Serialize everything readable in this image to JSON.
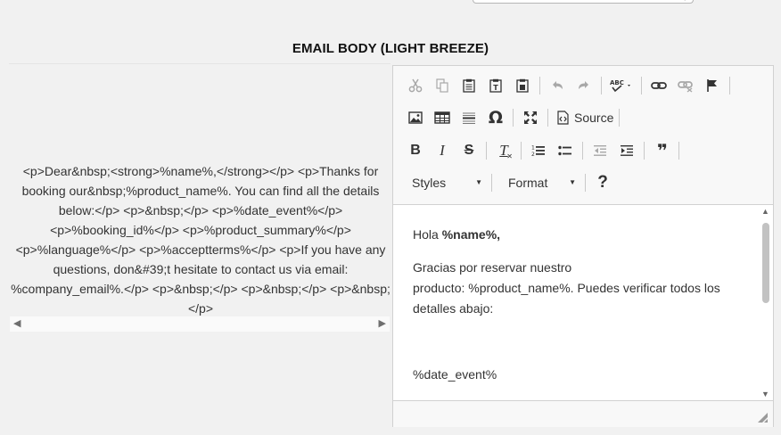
{
  "section": {
    "title": "EMAIL BODY (LIGHT BREEZE)"
  },
  "raw_html": {
    "text": "<p>Dear&nbsp;<strong>%name%,</strong></p> <p>Thanks for booking our&nbsp;%product_name%. You can find all the details below:</p> <p>&nbsp;</p> <p>%date_event%</p> <p>%booking_id%</p> <p>%product_summary%</p> <p>%language%</p> <p>%acceptterms%</p> <p>If you have any questions, don&#39;t hesitate to contact us via email: %company_email%.</p> <p>&nbsp;</p> <p>&nbsp;</p> <p>&nbsp;</p>"
  },
  "toolbar": {
    "row1": [
      "cut-icon",
      "copy-icon",
      "paste-icon",
      "paste-text-icon",
      "paste-word-icon",
      "undo-icon",
      "redo-icon",
      "spellcheck-icon",
      "link-icon",
      "unlink-icon",
      "anchor-flag-icon"
    ],
    "row2": [
      "image-icon",
      "table-icon",
      "horizontal-rule-icon",
      "special-char-icon",
      "maximize-icon",
      "source-icon"
    ],
    "row3": [
      "bold-icon",
      "italic-icon",
      "strike-icon",
      "remove-format-icon",
      "numbered-list-icon",
      "bulleted-list-icon",
      "outdent-icon",
      "indent-icon",
      "blockquote-icon"
    ],
    "source_label": "Source",
    "bold_glyph": "B",
    "italic_glyph": "I",
    "strike_glyph": "S",
    "remove_format_glyph": "T",
    "special_char_glyph": "Ω",
    "blockquote_glyph": "❜❜",
    "styles_label": "Styles",
    "format_label": "Format",
    "help_glyph": "?"
  },
  "editor": {
    "greeting_prefix": "Hola ",
    "greeting_name": "%name%,",
    "para1_line1": "Gracias por reservar nuestro",
    "para1_line2": "producto: %product_name%. Puedes verificar todos los detalles abajo:",
    "date_event": "%date_event%"
  },
  "colors": {
    "background": "#f1f1f1",
    "editor_bg": "#f8f8f8",
    "border": "#d1d1d1"
  }
}
